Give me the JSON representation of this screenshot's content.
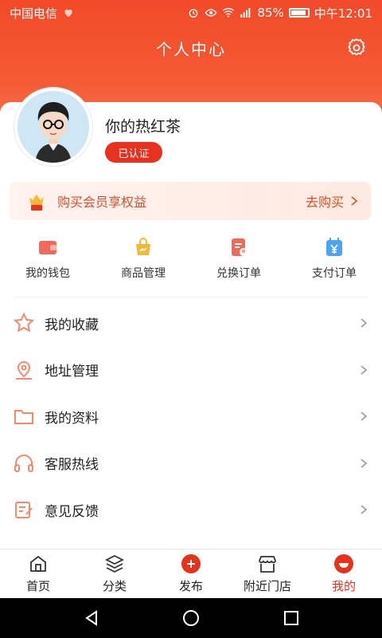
{
  "status_bar": {
    "carrier": "中国电信",
    "battery_percent": "85%",
    "time": "中午12:01"
  },
  "header": {
    "title": "个人中心",
    "settings_icon": "gear-icon"
  },
  "profile": {
    "name": "你的热红茶",
    "verified_badge": "已认证"
  },
  "vip_banner": {
    "text": "购买会员享权益",
    "cta": "去购买"
  },
  "quick_actions": [
    {
      "label": "我的钱包",
      "icon": "wallet-icon",
      "color": "#f06a5c"
    },
    {
      "label": "商品管理",
      "icon": "bag-icon",
      "color": "#f5b836"
    },
    {
      "label": "兑换订单",
      "icon": "document-icon",
      "color": "#f06a5c"
    },
    {
      "label": "支付订单",
      "icon": "yen-calendar-icon",
      "color": "#4ea3f5"
    }
  ],
  "menu": [
    {
      "label": "我的收藏",
      "icon": "star-icon"
    },
    {
      "label": "地址管理",
      "icon": "location-icon"
    },
    {
      "label": "我的资料",
      "icon": "folder-icon"
    },
    {
      "label": "客服热线",
      "icon": "headset-icon"
    },
    {
      "label": "意见反馈",
      "icon": "feedback-icon"
    }
  ],
  "tabs": [
    {
      "label": "首页",
      "icon": "home-icon",
      "active": false
    },
    {
      "label": "分类",
      "icon": "layers-icon",
      "active": false
    },
    {
      "label": "发布",
      "icon": "plus-circle-icon",
      "active": false
    },
    {
      "label": "附近门店",
      "icon": "store-icon",
      "active": false
    },
    {
      "label": "我的",
      "icon": "profile-icon",
      "active": true
    }
  ],
  "colors": {
    "accent": "#e8311f",
    "header_start": "#f24a2a",
    "header_end": "#f7764e",
    "menu_icon": "#f28a6b"
  }
}
